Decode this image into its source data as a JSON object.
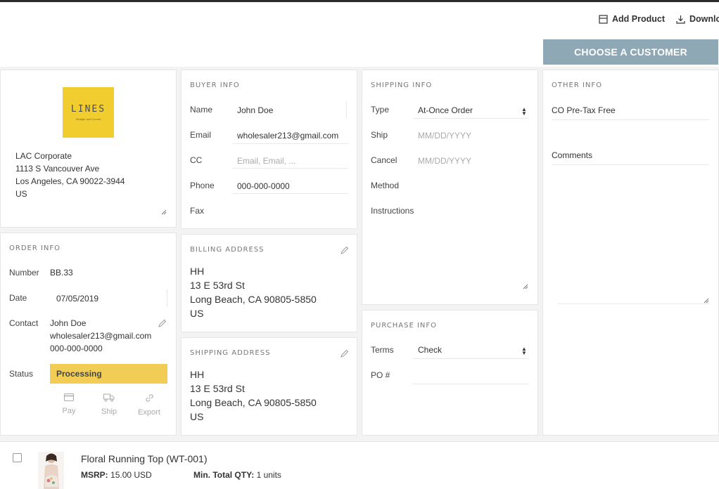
{
  "toolbar": {
    "add_product": "Add Product",
    "download": "Downlo"
  },
  "choose_customer": "CHOOSE A CUSTOMER",
  "company": {
    "logo_text": "LINES",
    "logo_tagline": "Straight and Curved",
    "address_lines": [
      "LAC Corporate",
      "1113 S Vancouver Ave",
      "Los Angeles, CA 90022-3944",
      "US"
    ]
  },
  "buyer": {
    "title": "BUYER INFO",
    "name_label": "Name",
    "name_value": "John Doe",
    "email_label": "Email",
    "email_value": "wholesaler213@gmail.com",
    "cc_label": "CC",
    "cc_placeholder": "Email, Email, ...",
    "phone_label": "Phone",
    "phone_value": "000-000-0000",
    "fax_label": "Fax"
  },
  "shipping_info": {
    "title": "SHIPPING INFO",
    "type_label": "Type",
    "type_value": "At-Once Order",
    "ship_label": "Ship",
    "ship_placeholder": "MM/DD/YYYY",
    "cancel_label": "Cancel",
    "cancel_placeholder": "MM/DD/YYYY",
    "method_label": "Method",
    "instructions_label": "Instructions"
  },
  "other_info": {
    "title": "OTHER INFO",
    "co_pretax": "CO Pre-Tax Free",
    "comments_label": "Comments"
  },
  "order_info": {
    "title": "ORDER INFO",
    "number_label": "Number",
    "number_value": "BB.33",
    "date_label": "Date",
    "date_value": "07/05/2019",
    "contact_label": "Contact",
    "contact_lines": [
      "John Doe",
      "wholesaler213@gmail.com",
      "000-000-0000"
    ],
    "status_label": "Status",
    "status_value": "Processing",
    "actions": [
      "Pay",
      "Ship",
      "Export"
    ]
  },
  "billing": {
    "title": "BILLING ADDRESS",
    "lines": [
      "HH",
      "13 E 53rd St",
      "Long Beach, CA 90805-5850",
      "US"
    ]
  },
  "shipping_address": {
    "title": "SHIPPING ADDRESS",
    "lines": [
      "HH",
      "13 E 53rd St",
      "Long Beach, CA 90805-5850",
      "US"
    ]
  },
  "purchase": {
    "title": "PURCHASE INFO",
    "terms_label": "Terms",
    "terms_value": "Check",
    "po_label": "PO #"
  },
  "product": {
    "name": "Floral Running Top (WT-001)",
    "msrp_label": "MSRP:",
    "msrp_value": "15.00 USD",
    "min_qty_label": "Min. Total QTY:",
    "min_qty_value": "1 units"
  },
  "colors": {
    "choose_button": "#8fa8b6",
    "status_processing": "#f2cd55",
    "logo_bg": "#f2cd2f"
  }
}
